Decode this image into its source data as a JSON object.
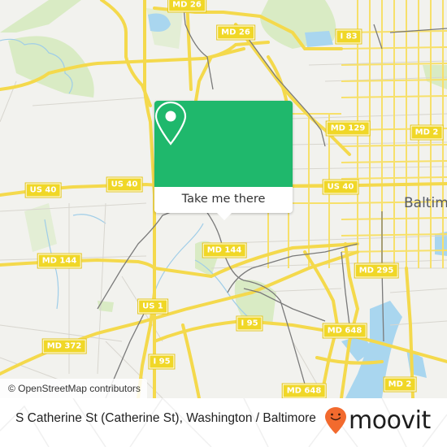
{
  "map": {
    "road_labels": [
      {
        "id": "md26-top",
        "text": "MD 26"
      },
      {
        "id": "md26-mid",
        "text": "MD 26"
      },
      {
        "id": "i83",
        "text": "I 83"
      },
      {
        "id": "md129",
        "text": "MD 129"
      },
      {
        "id": "md2-top",
        "text": "MD 2"
      },
      {
        "id": "us40-left",
        "text": "US 40"
      },
      {
        "id": "us40-mid",
        "text": "US 40"
      },
      {
        "id": "us40-right",
        "text": "US 40"
      },
      {
        "id": "md144-left",
        "text": "MD 144"
      },
      {
        "id": "md144-mid",
        "text": "MD 144"
      },
      {
        "id": "md295",
        "text": "MD 295"
      },
      {
        "id": "us1",
        "text": "US 1"
      },
      {
        "id": "i95-mid",
        "text": "I 95"
      },
      {
        "id": "md648-top",
        "text": "MD 648"
      },
      {
        "id": "md372",
        "text": "MD 372"
      },
      {
        "id": "i95-left",
        "text": "I 95"
      },
      {
        "id": "md648-bottom",
        "text": "MD 648"
      },
      {
        "id": "md2-bottom",
        "text": "MD 2"
      }
    ],
    "city_label": "Baltim",
    "attribution": "© OpenStreetMap contributors",
    "colors": {
      "land": "#f2f2ee",
      "park": "#d9ebc4",
      "water": "#a9d6ef",
      "road_major": "#f7e06a",
      "road_minor": "#d8d6cf",
      "rail": "#7a7a7a",
      "shield": "#f0d727"
    }
  },
  "popup": {
    "icon": "map-pin-icon",
    "button_label": "Take me there",
    "color": "#1fb86c"
  },
  "footer": {
    "location_text": "S Catherine St (Catherine St), Washington / Baltimore",
    "brand": "moovit",
    "brand_icon": "moovit-smile-pin-icon",
    "brand_color": "#f26a2e"
  }
}
